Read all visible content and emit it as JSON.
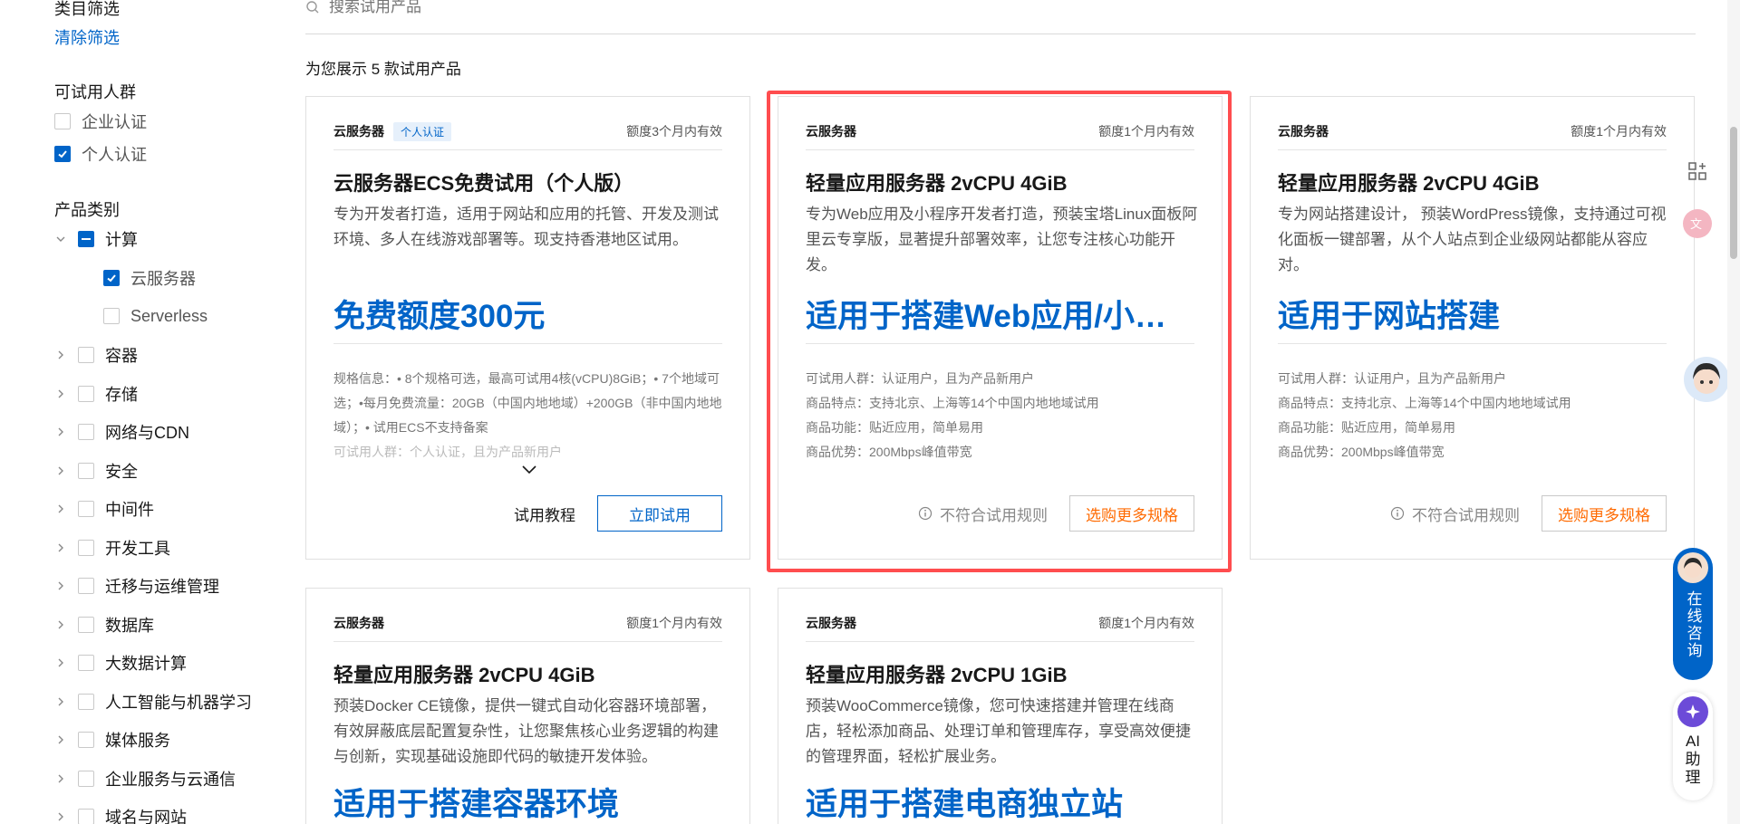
{
  "sidebar": {
    "category_filter_title": "类目筛选",
    "clear_filter": "清除筛选",
    "audience_title": "可试用人群",
    "audience": [
      {
        "label": "企业认证",
        "checked": false
      },
      {
        "label": "个人认证",
        "checked": true
      }
    ],
    "product_title": "产品类别",
    "compute": {
      "label": "计算",
      "state": "partial"
    },
    "compute_children": [
      {
        "label": "云服务器",
        "checked": true
      },
      {
        "label": "Serverless",
        "checked": false
      }
    ],
    "categories": [
      {
        "label": "容器"
      },
      {
        "label": "存储"
      },
      {
        "label": "网络与CDN"
      },
      {
        "label": "安全"
      },
      {
        "label": "中间件"
      },
      {
        "label": "开发工具"
      },
      {
        "label": "迁移与运维管理"
      },
      {
        "label": "数据库"
      },
      {
        "label": "大数据计算"
      },
      {
        "label": "人工智能与机器学习"
      },
      {
        "label": "媒体服务"
      },
      {
        "label": "企业服务与云通信"
      },
      {
        "label": "域名与网站"
      }
    ]
  },
  "search": {
    "placeholder": "搜索试用产品"
  },
  "result_count": "为您展示 5 款试用产品",
  "cards": [
    {
      "category": "云服务器",
      "tag": "个人认证",
      "validity": "额度3个月内有效",
      "name": "云服务器ECS免费试用（个人版）",
      "desc": "专为开发者打造，适用于网站和应用的托管、开发及测试环境、多人在线游戏部署等。现支持香港地区试用。",
      "headline": "免费额度300元",
      "info1": "规格信息：• 8个规格可选，最高可试用4核(vCPU)8GiB；• 7个地域可选；•每月免费流量：20GB（中国内地地域）+200GB（非中国内地地域）；• 试用ECS不支持备案",
      "info2": "可试用人群：个人认证，且为产品新用户",
      "tutorial": "试用教程",
      "try_now": "立即试用"
    },
    {
      "category": "云服务器",
      "validity": "额度1个月内有效",
      "name": "轻量应用服务器 2vCPU 4GiB",
      "desc": "专为Web应用及小程序开发者打造，预装宝塔Linux面板阿里云专享版，显著提升部署效率，让您专注核心功能开发。",
      "headline": "适用于搭建Web应用/小程序",
      "info": [
        "可试用人群：认证用户，且为产品新用户",
        "商品特点：支持北京、上海等14个中国内地地域试用",
        "商品功能：贴近应用，简单易用",
        "商品优势：200Mbps峰值带宽"
      ],
      "notice": "不符合试用规则",
      "more": "选购更多规格"
    },
    {
      "category": "云服务器",
      "validity": "额度1个月内有效",
      "name": "轻量应用服务器 2vCPU 4GiB",
      "desc": "专为网站搭建设计， 预装WordPress镜像，支持通过可视化面板一键部署，从个人站点到企业级网站都能从容应对。",
      "headline": "适用于网站搭建",
      "info": [
        "可试用人群：认证用户，且为产品新用户",
        "商品特点：支持北京、上海等14个中国内地地域试用",
        "商品功能：贴近应用，简单易用",
        "商品优势：200Mbps峰值带宽"
      ],
      "notice": "不符合试用规则",
      "more": "选购更多规格"
    },
    {
      "category": "云服务器",
      "validity": "额度1个月内有效",
      "name": "轻量应用服务器 2vCPU 4GiB",
      "desc": "预装Docker CE镜像，提供一键式自动化容器环境部署，有效屏蔽底层配置复杂性，让您聚焦核心业务逻辑的构建与创新，实现基础设施即代码的敏捷开发体验。",
      "headline": "适用于搭建容器环境"
    },
    {
      "category": "云服务器",
      "validity": "额度1个月内有效",
      "name": "轻量应用服务器 2vCPU 1GiB",
      "desc": "预装WooCommerce镜像，您可快速搭建并管理在线商店，轻松添加商品、处理订单和管理库存，享受高效便捷的管理界面，轻松扩展业务。",
      "headline": "适用于搭建电商独立站"
    }
  ],
  "float": {
    "consult": "在线咨询",
    "ai": "AI助理"
  },
  "colors": {
    "accent": "#0064c8",
    "orange": "#ff6a00",
    "highlight": "#ff4d4f"
  }
}
